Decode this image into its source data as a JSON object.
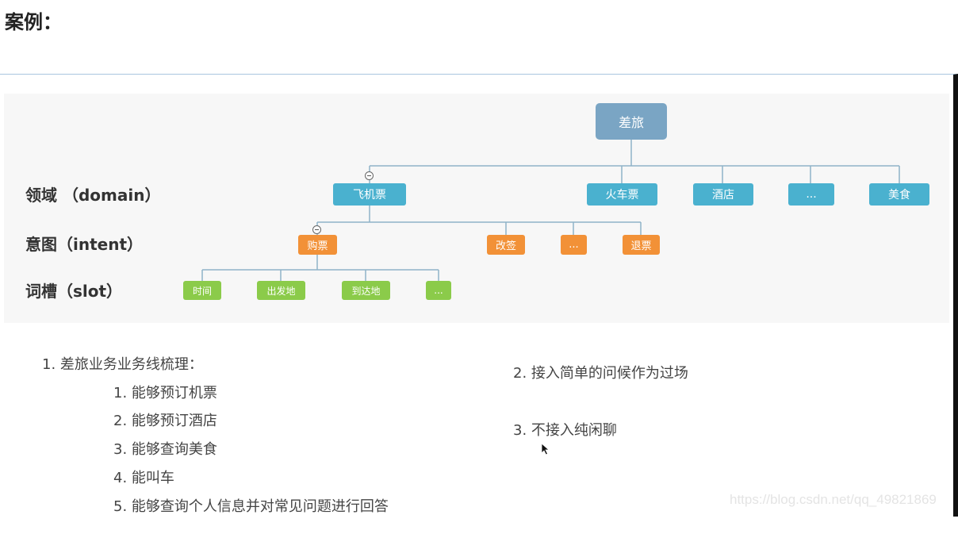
{
  "page_title": "案例：",
  "row_labels": {
    "domain": "领域 （domain）",
    "intent": "意图（intent）",
    "slot": "词槽（slot）"
  },
  "tree": {
    "root": "差旅",
    "domains": [
      "飞机票",
      "火车票",
      "酒店",
      "...",
      "美食"
    ],
    "intents": [
      "购票",
      "改签",
      "...",
      "退票"
    ],
    "slots": [
      "时间",
      "出发地",
      "到达地",
      "..."
    ]
  },
  "notes": {
    "heading": "1. 差旅业务业务线梳理：",
    "sub_items": [
      "1. 能够预订机票",
      "2. 能够预订酒店",
      "3. 能够查询美食",
      "4. 能叫车",
      "5. 能够查询个人信息并对常见问题进行回答"
    ],
    "right_items": [
      "2. 接入简单的问候作为过场",
      "3. 不接入纯闲聊"
    ]
  },
  "watermark": "https://blog.csdn.net/qq_49821869",
  "colors": {
    "root": "#7aa5c4",
    "domain": "#4ab1cf",
    "intent": "#f29137",
    "slot": "#8bcb4a",
    "connector": "#8fb3c8"
  }
}
